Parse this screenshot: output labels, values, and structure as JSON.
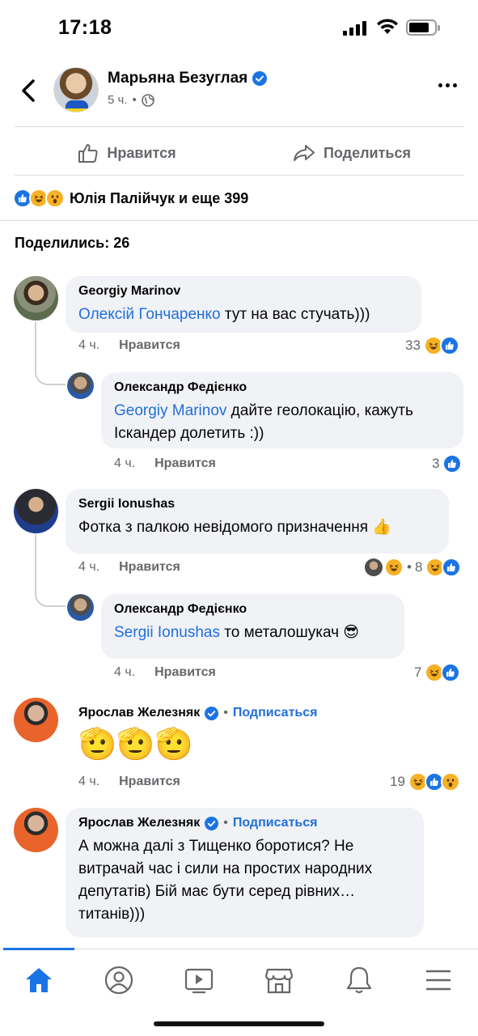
{
  "status": {
    "time": "17:18"
  },
  "post": {
    "author": "Марьяна Безуглая",
    "time": "5 ч.",
    "separator": "•",
    "like_label": "Нравится",
    "share_label": "Поделиться",
    "reactions_text": "Юлія Палійчук и еще 399",
    "shares_text": "Поделились: 26"
  },
  "comments": [
    {
      "author": "Georgiy Marinov",
      "mention": "Олексій Гончаренко",
      "text": " тут на вас стучать)))",
      "time": "4 ч.",
      "like": "Нравится",
      "count": "33"
    },
    {
      "author": "Олександр Федієнко",
      "mention": "Georgiy Marinov",
      "text": " дайте геолокацію, кажуть Іскандер долетить :))",
      "time": "4 ч.",
      "like": "Нравится",
      "count": "3"
    },
    {
      "author": "Sergii Ionushas",
      "text": "Фотка з палкою невідомого призначення 👍",
      "time": "4 ч.",
      "like": "Нравится",
      "reply_count": "8",
      "sep": "•"
    },
    {
      "author": "Олександр Федієнко",
      "mention": "Sergii Ionushas",
      "text": " то металошукач 😎",
      "time": "4 ч.",
      "like": "Нравится",
      "count": "7"
    },
    {
      "author": "Ярослав Железняк",
      "follow": "Подписаться",
      "sep": "•",
      "text": "🫡🫡🫡",
      "time": "4 ч.",
      "like": "Нравится",
      "count": "19"
    },
    {
      "author": "Ярослав Железняк",
      "follow": "Подписаться",
      "sep": "•",
      "text": "А можна далі з Тищенко боротися? Не витрачай час і сили на простих народних депутатів) Бій має бути серед рівних… титанів)))"
    }
  ],
  "icons": {
    "back": "chevron-left-icon",
    "verified": "verified-badge-icon",
    "privacy": "globe-icon",
    "more": "more-horizontal-icon",
    "like": "thumbs-up-icon",
    "share": "share-arrow-icon",
    "tabs": [
      "home-icon",
      "profile-icon",
      "video-icon",
      "marketplace-icon",
      "bell-icon",
      "menu-icon"
    ]
  },
  "colors": {
    "accent": "#1b74e4",
    "mention": "#216fdb",
    "bubble": "#f0f2f5"
  }
}
